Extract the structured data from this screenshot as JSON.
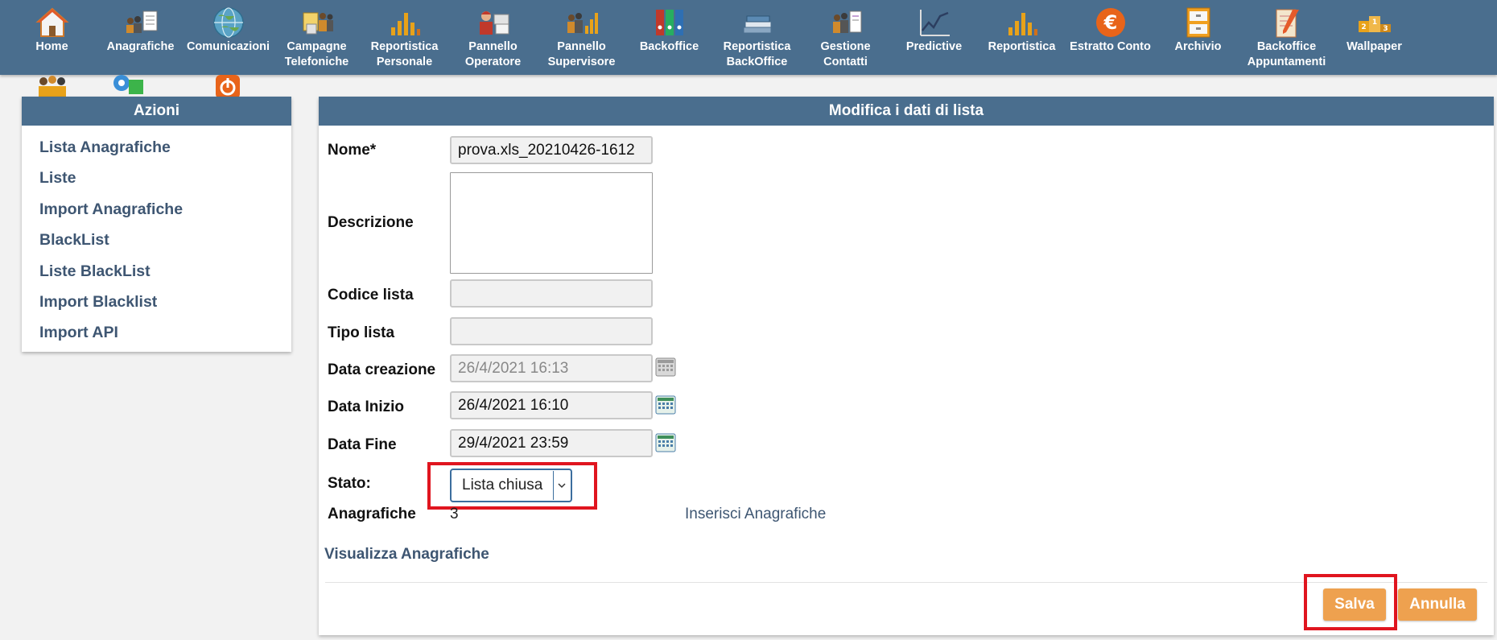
{
  "nav": {
    "items": [
      {
        "label": "Home",
        "icon": "home-icon"
      },
      {
        "label": "Anagrafiche",
        "icon": "people-card-icon"
      },
      {
        "label": "Comunicazioni",
        "icon": "globe-icon"
      },
      {
        "label": "Campagne Telefoniche",
        "icon": "campaign-people-icon"
      },
      {
        "label": "Reportistica Personale",
        "icon": "bar-chart-icon"
      },
      {
        "label": "Pannello Operatore",
        "icon": "operator-icon"
      },
      {
        "label": "Pannello Supervisore",
        "icon": "supervisor-chart-icon"
      },
      {
        "label": "Backoffice",
        "icon": "binders-icon"
      },
      {
        "label": "Reportistica BackOffice",
        "icon": "book-stack-icon"
      },
      {
        "label": "Gestione Contatti",
        "icon": "contacts-icon"
      },
      {
        "label": "Predictive",
        "icon": "trend-chart-icon"
      },
      {
        "label": "Reportistica",
        "icon": "bar-chart-icon"
      },
      {
        "label": "Estratto Conto",
        "icon": "euro-icon"
      },
      {
        "label": "Archivio",
        "icon": "file-cabinet-icon"
      },
      {
        "label": "Backoffice Appuntamenti",
        "icon": "notepad-pencil-icon"
      },
      {
        "label": "Wallpaper",
        "icon": "podium-icon"
      }
    ]
  },
  "sidebar": {
    "title": "Azioni",
    "items": [
      "Lista Anagrafiche",
      "Liste",
      "Import Anagrafiche",
      "BlackList",
      "Liste BlackList",
      "Import Blacklist",
      "Import API"
    ]
  },
  "form": {
    "title": "Modifica i dati di lista",
    "nome_label": "Nome*",
    "nome_value": "prova.xls_20210426-1612",
    "descrizione_label": "Descrizione",
    "descrizione_value": "",
    "codice_label": "Codice lista",
    "codice_value": "",
    "tipo_label": "Tipo lista",
    "tipo_value": "",
    "creazione_label": "Data creazione",
    "creazione_value": "26/4/2021 16:13",
    "inizio_label": "Data Inizio",
    "inizio_value": "26/4/2021 16:10",
    "fine_label": "Data Fine",
    "fine_value": "29/4/2021 23:59",
    "stato_label": "Stato:",
    "stato_value": "Lista chiusa",
    "anagrafiche_label": "Anagrafiche",
    "anagrafiche_count": "3",
    "inserisci_link": "Inserisci Anagrafiche",
    "visualizza_link": "Visualizza Anagrafiche",
    "save_label": "Salva",
    "cancel_label": "Annulla"
  },
  "colors": {
    "header": "#4a6e8e",
    "button": "#eea14f",
    "highlight": "#e0151f",
    "link": "#3e5672"
  }
}
